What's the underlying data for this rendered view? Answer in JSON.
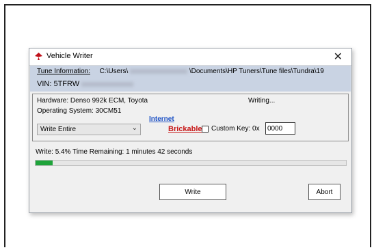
{
  "window": {
    "title": "Vehicle Writer",
    "close_glyph": "✕",
    "icon": "hp-tuners-logo-icon",
    "icon_color": "#c0101a"
  },
  "tune_info": {
    "label": "Tune Information:",
    "path_start": "C:\\Users\\",
    "path_end": "\\Documents\\HP Tuners\\Tune files\\Tundra\\19",
    "vin_label": "VIN: 5TFRW"
  },
  "vehicle": {
    "hardware": "Hardware: Denso 992k ECM,  Toyota",
    "status": "Writing...",
    "operating_system": "Operating System: 30CM51"
  },
  "links": {
    "internet": "Internet",
    "brickable": "Brickable"
  },
  "write_mode": {
    "selected": "Write Entire"
  },
  "custom_key": {
    "label": "Custom Key: 0x",
    "value": "0000",
    "checked": false
  },
  "progress": {
    "text": "Write: 5.4% Time Remaining: 1 minutes 42 seconds",
    "fraction": 0.054,
    "bar_color": "#1ea33a"
  },
  "buttons": {
    "write": "Write",
    "abort": "Abort"
  }
}
